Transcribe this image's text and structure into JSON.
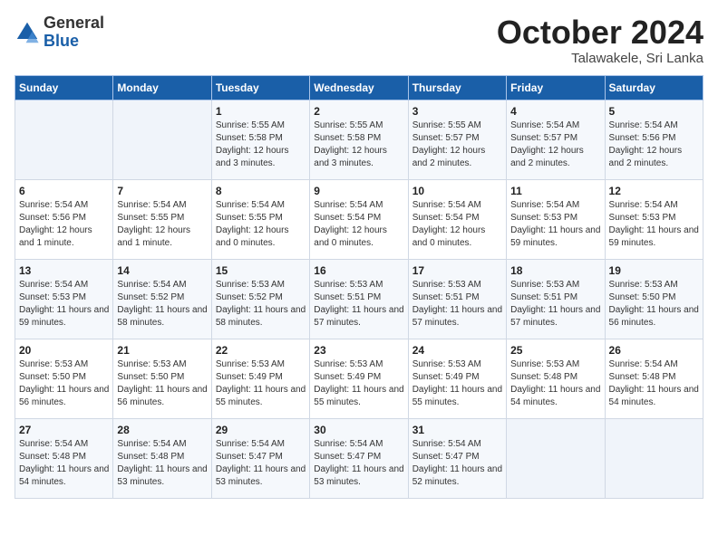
{
  "logo": {
    "general": "General",
    "blue": "Blue"
  },
  "title": "October 2024",
  "subtitle": "Talawakele, Sri Lanka",
  "days_of_week": [
    "Sunday",
    "Monday",
    "Tuesday",
    "Wednesday",
    "Thursday",
    "Friday",
    "Saturday"
  ],
  "weeks": [
    [
      {
        "day": "",
        "info": ""
      },
      {
        "day": "",
        "info": ""
      },
      {
        "day": "1",
        "info": "Sunrise: 5:55 AM\nSunset: 5:58 PM\nDaylight: 12 hours and 3 minutes."
      },
      {
        "day": "2",
        "info": "Sunrise: 5:55 AM\nSunset: 5:58 PM\nDaylight: 12 hours and 3 minutes."
      },
      {
        "day": "3",
        "info": "Sunrise: 5:55 AM\nSunset: 5:57 PM\nDaylight: 12 hours and 2 minutes."
      },
      {
        "day": "4",
        "info": "Sunrise: 5:54 AM\nSunset: 5:57 PM\nDaylight: 12 hours and 2 minutes."
      },
      {
        "day": "5",
        "info": "Sunrise: 5:54 AM\nSunset: 5:56 PM\nDaylight: 12 hours and 2 minutes."
      }
    ],
    [
      {
        "day": "6",
        "info": "Sunrise: 5:54 AM\nSunset: 5:56 PM\nDaylight: 12 hours and 1 minute."
      },
      {
        "day": "7",
        "info": "Sunrise: 5:54 AM\nSunset: 5:55 PM\nDaylight: 12 hours and 1 minute."
      },
      {
        "day": "8",
        "info": "Sunrise: 5:54 AM\nSunset: 5:55 PM\nDaylight: 12 hours and 0 minutes."
      },
      {
        "day": "9",
        "info": "Sunrise: 5:54 AM\nSunset: 5:54 PM\nDaylight: 12 hours and 0 minutes."
      },
      {
        "day": "10",
        "info": "Sunrise: 5:54 AM\nSunset: 5:54 PM\nDaylight: 12 hours and 0 minutes."
      },
      {
        "day": "11",
        "info": "Sunrise: 5:54 AM\nSunset: 5:53 PM\nDaylight: 11 hours and 59 minutes."
      },
      {
        "day": "12",
        "info": "Sunrise: 5:54 AM\nSunset: 5:53 PM\nDaylight: 11 hours and 59 minutes."
      }
    ],
    [
      {
        "day": "13",
        "info": "Sunrise: 5:54 AM\nSunset: 5:53 PM\nDaylight: 11 hours and 59 minutes."
      },
      {
        "day": "14",
        "info": "Sunrise: 5:54 AM\nSunset: 5:52 PM\nDaylight: 11 hours and 58 minutes."
      },
      {
        "day": "15",
        "info": "Sunrise: 5:53 AM\nSunset: 5:52 PM\nDaylight: 11 hours and 58 minutes."
      },
      {
        "day": "16",
        "info": "Sunrise: 5:53 AM\nSunset: 5:51 PM\nDaylight: 11 hours and 57 minutes."
      },
      {
        "day": "17",
        "info": "Sunrise: 5:53 AM\nSunset: 5:51 PM\nDaylight: 11 hours and 57 minutes."
      },
      {
        "day": "18",
        "info": "Sunrise: 5:53 AM\nSunset: 5:51 PM\nDaylight: 11 hours and 57 minutes."
      },
      {
        "day": "19",
        "info": "Sunrise: 5:53 AM\nSunset: 5:50 PM\nDaylight: 11 hours and 56 minutes."
      }
    ],
    [
      {
        "day": "20",
        "info": "Sunrise: 5:53 AM\nSunset: 5:50 PM\nDaylight: 11 hours and 56 minutes."
      },
      {
        "day": "21",
        "info": "Sunrise: 5:53 AM\nSunset: 5:50 PM\nDaylight: 11 hours and 56 minutes."
      },
      {
        "day": "22",
        "info": "Sunrise: 5:53 AM\nSunset: 5:49 PM\nDaylight: 11 hours and 55 minutes."
      },
      {
        "day": "23",
        "info": "Sunrise: 5:53 AM\nSunset: 5:49 PM\nDaylight: 11 hours and 55 minutes."
      },
      {
        "day": "24",
        "info": "Sunrise: 5:53 AM\nSunset: 5:49 PM\nDaylight: 11 hours and 55 minutes."
      },
      {
        "day": "25",
        "info": "Sunrise: 5:53 AM\nSunset: 5:48 PM\nDaylight: 11 hours and 54 minutes."
      },
      {
        "day": "26",
        "info": "Sunrise: 5:54 AM\nSunset: 5:48 PM\nDaylight: 11 hours and 54 minutes."
      }
    ],
    [
      {
        "day": "27",
        "info": "Sunrise: 5:54 AM\nSunset: 5:48 PM\nDaylight: 11 hours and 54 minutes."
      },
      {
        "day": "28",
        "info": "Sunrise: 5:54 AM\nSunset: 5:48 PM\nDaylight: 11 hours and 53 minutes."
      },
      {
        "day": "29",
        "info": "Sunrise: 5:54 AM\nSunset: 5:47 PM\nDaylight: 11 hours and 53 minutes."
      },
      {
        "day": "30",
        "info": "Sunrise: 5:54 AM\nSunset: 5:47 PM\nDaylight: 11 hours and 53 minutes."
      },
      {
        "day": "31",
        "info": "Sunrise: 5:54 AM\nSunset: 5:47 PM\nDaylight: 11 hours and 52 minutes."
      },
      {
        "day": "",
        "info": ""
      },
      {
        "day": "",
        "info": ""
      }
    ]
  ]
}
